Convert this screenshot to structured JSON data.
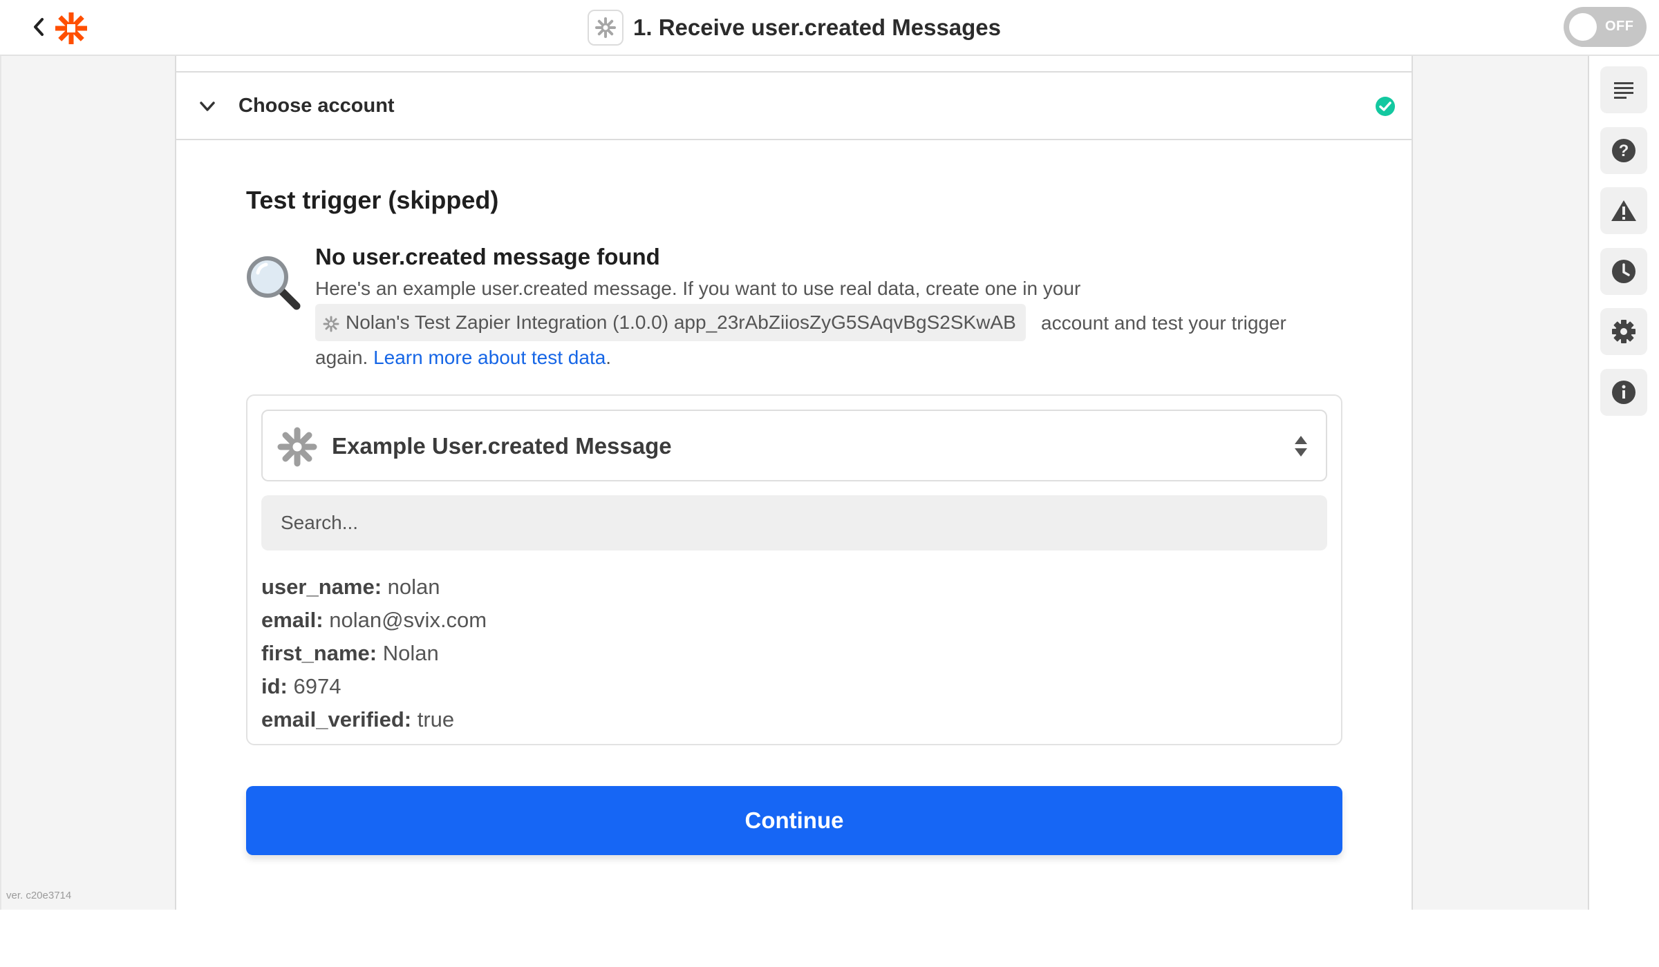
{
  "header": {
    "title": "1. Receive user.created Messages",
    "toggle_label": "OFF"
  },
  "choose_account": {
    "label": "Choose account"
  },
  "test_trigger": {
    "title": "Test trigger (skipped)",
    "not_found_title": "No user.created message found",
    "text_line1": "Here's an example user.created message. If you want to use real data, create one in your",
    "app_chip": "Nolan's Test Zapier Integration (1.0.0) app_23rAbZiiosZyG5SAqvBgS2SKwAB",
    "text_after_chip": "account and test your trigger",
    "text_again": "again.",
    "learn_link": "Learn more about test data",
    "period": "."
  },
  "sample": {
    "selected": "Example User.created Message",
    "search_placeholder": "Search...",
    "fields": [
      {
        "key": "user_name:",
        "value": "nolan"
      },
      {
        "key": "email:",
        "value": "nolan@svix.com"
      },
      {
        "key": "first_name:",
        "value": "Nolan"
      },
      {
        "key": "id:",
        "value": "6974"
      },
      {
        "key": "email_verified:",
        "value": "true"
      }
    ]
  },
  "continue_label": "Continue",
  "version": "ver. c20e3714",
  "colors": {
    "accent": "#1666f5",
    "link": "#1666e6",
    "zapier_orange": "#ff4f00",
    "success": "#13c8a0"
  },
  "rail_icons": [
    "outline-icon",
    "help-icon",
    "warning-icon",
    "history-icon",
    "settings-icon",
    "info-icon"
  ]
}
